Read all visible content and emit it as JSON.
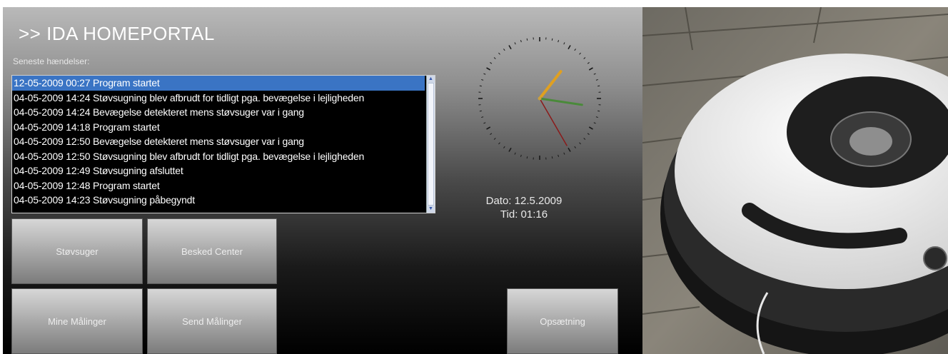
{
  "app": {
    "title": ">> IDA HOMEPORTAL",
    "events_label": "Seneste hændelser:"
  },
  "events": [
    {
      "text": "12-05-2009 00:27 Program startet",
      "selected": true
    },
    {
      "text": "04-05-2009 14:24 Støvsugning blev afbrudt for tidligt pga. bevægelse i lejligheden",
      "selected": false
    },
    {
      "text": "04-05-2009 14:24 Bevægelse detekteret mens støvsuger var i gang",
      "selected": false
    },
    {
      "text": "04-05-2009 14:18 Program startet",
      "selected": false
    },
    {
      "text": "04-05-2009 12:50 Bevægelse detekteret mens støvsuger var i gang",
      "selected": false
    },
    {
      "text": "04-05-2009 12:50 Støvsugning blev afbrudt for tidligt pga. bevægelse i lejligheden",
      "selected": false
    },
    {
      "text": "04-05-2009 12:49 Støvsugning afsluttet",
      "selected": false
    },
    {
      "text": "04-05-2009 12:48 Program startet",
      "selected": false
    },
    {
      "text": "04-05-2009 14:23 Støvsugning påbegyndt",
      "selected": false
    }
  ],
  "clock": {
    "hour": 1,
    "minute": 16,
    "second": 25,
    "hour_hand_color": "#e0a020",
    "minute_hand_color": "#4a8a3a",
    "second_hand_color": "#8b1a1a"
  },
  "datetime": {
    "date": "Dato: 12.5.2009",
    "time": "Tid: 01:16"
  },
  "buttons": {
    "stovsuger": "Støvsuger",
    "besked_center": "Besked Center",
    "mine_malinger": "Mine Målinger",
    "send_malinger": "Send Målinger",
    "opsaetning": "Opsætning"
  },
  "scrollbar": {
    "up_icon": "▲",
    "down_icon": "▼"
  }
}
